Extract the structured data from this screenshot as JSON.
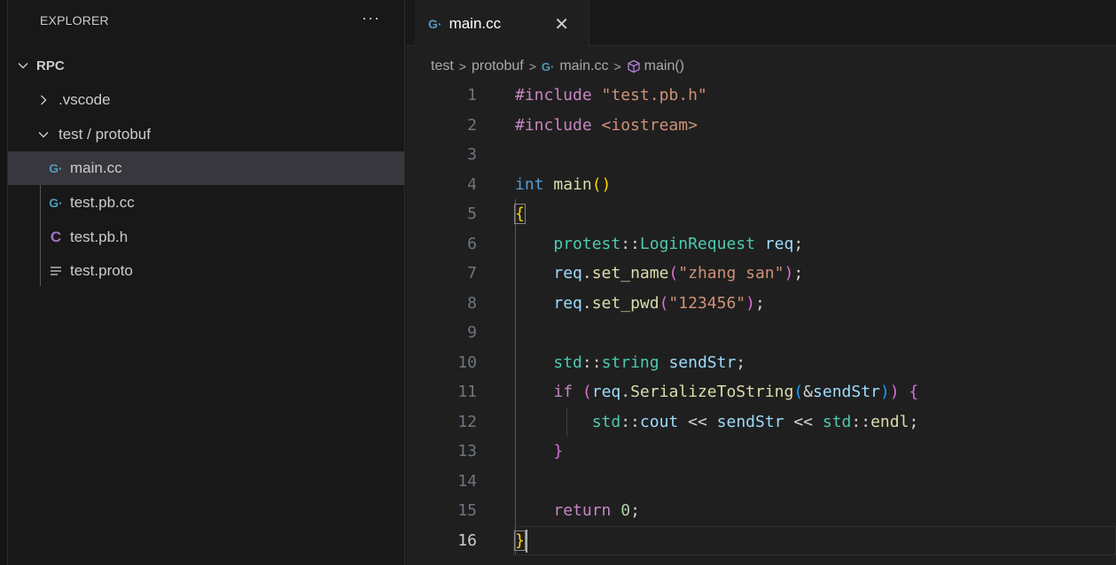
{
  "sidebar": {
    "title": "EXPLORER",
    "more": "···",
    "tree": [
      {
        "label": "RPC",
        "chevron": "down"
      },
      {
        "label": ".vscode",
        "chevron": "right"
      },
      {
        "label": "test / protobuf",
        "chevron": "down"
      },
      {
        "label": "main.cc",
        "icon": "cpp-file-icon",
        "selected": true
      },
      {
        "label": "test.pb.cc",
        "icon": "cpp-file-icon"
      },
      {
        "label": "test.pb.h",
        "icon": "c-header-file-icon"
      },
      {
        "label": "test.proto",
        "icon": "text-file-icon"
      }
    ]
  },
  "editor": {
    "tab": {
      "label": "main.cc",
      "close": "✕"
    },
    "breadcrumb": [
      "test",
      "protobuf",
      "main.cc",
      "main()"
    ],
    "active_line": 16,
    "lines": [
      {
        "n": "1"
      },
      {
        "n": "2"
      },
      {
        "n": "3"
      },
      {
        "n": "4"
      },
      {
        "n": "5"
      },
      {
        "n": "6"
      },
      {
        "n": "7"
      },
      {
        "n": "8"
      },
      {
        "n": "9"
      },
      {
        "n": "10"
      },
      {
        "n": "11"
      },
      {
        "n": "12"
      },
      {
        "n": "13"
      },
      {
        "n": "14"
      },
      {
        "n": "15"
      },
      {
        "n": "16"
      }
    ],
    "code_text": {
      "l1_kw": "#include",
      "l1_str": "\"test.pb.h\"",
      "l2_kw": "#include",
      "l2_str": "<iostream>",
      "l4_type": "int",
      "l4_fn": "main",
      "l4_paren": "()",
      "l5_brace": "{",
      "l6_ns": "protest",
      "l6_sep": "::",
      "l6_type": "LoginRequest",
      "l6_var": "req",
      "l6_end": ";",
      "l7_var": "req",
      "l7_dot": ".",
      "l7_fn": "set_name",
      "l7_open": "(",
      "l7_str": "\"zhang san\"",
      "l7_close": ")",
      "l7_end": ";",
      "l8_var": "req",
      "l8_dot": ".",
      "l8_fn": "set_pwd",
      "l8_open": "(",
      "l8_str": "\"123456\"",
      "l8_close": ")",
      "l8_end": ";",
      "l10_ns": "std",
      "l10_sep": "::",
      "l10_type": "string",
      "l10_var": "sendStr",
      "l10_end": ";",
      "l11_if": "if",
      "l11_open": "(",
      "l11_var": "req",
      "l11_dot": ".",
      "l11_fn": "SerializeToString",
      "l11_open2": "(",
      "l11_amp": "&",
      "l11_var2": "sendStr",
      "l11_close2": ")",
      "l11_close": ")",
      "l11_brace": "{",
      "l12_ns": "std",
      "l12_sep": "::",
      "l12_var": "cout",
      "l12_op": "<<",
      "l12_var2": "sendStr",
      "l12_op2": "<<",
      "l12_ns2": "std",
      "l12_sep2": "::",
      "l12_fn": "endl",
      "l12_end": ";",
      "l13_brace": "}",
      "l15_ret": "return",
      "l15_num": "0",
      "l15_end": ";",
      "l16_brace": "}"
    }
  }
}
